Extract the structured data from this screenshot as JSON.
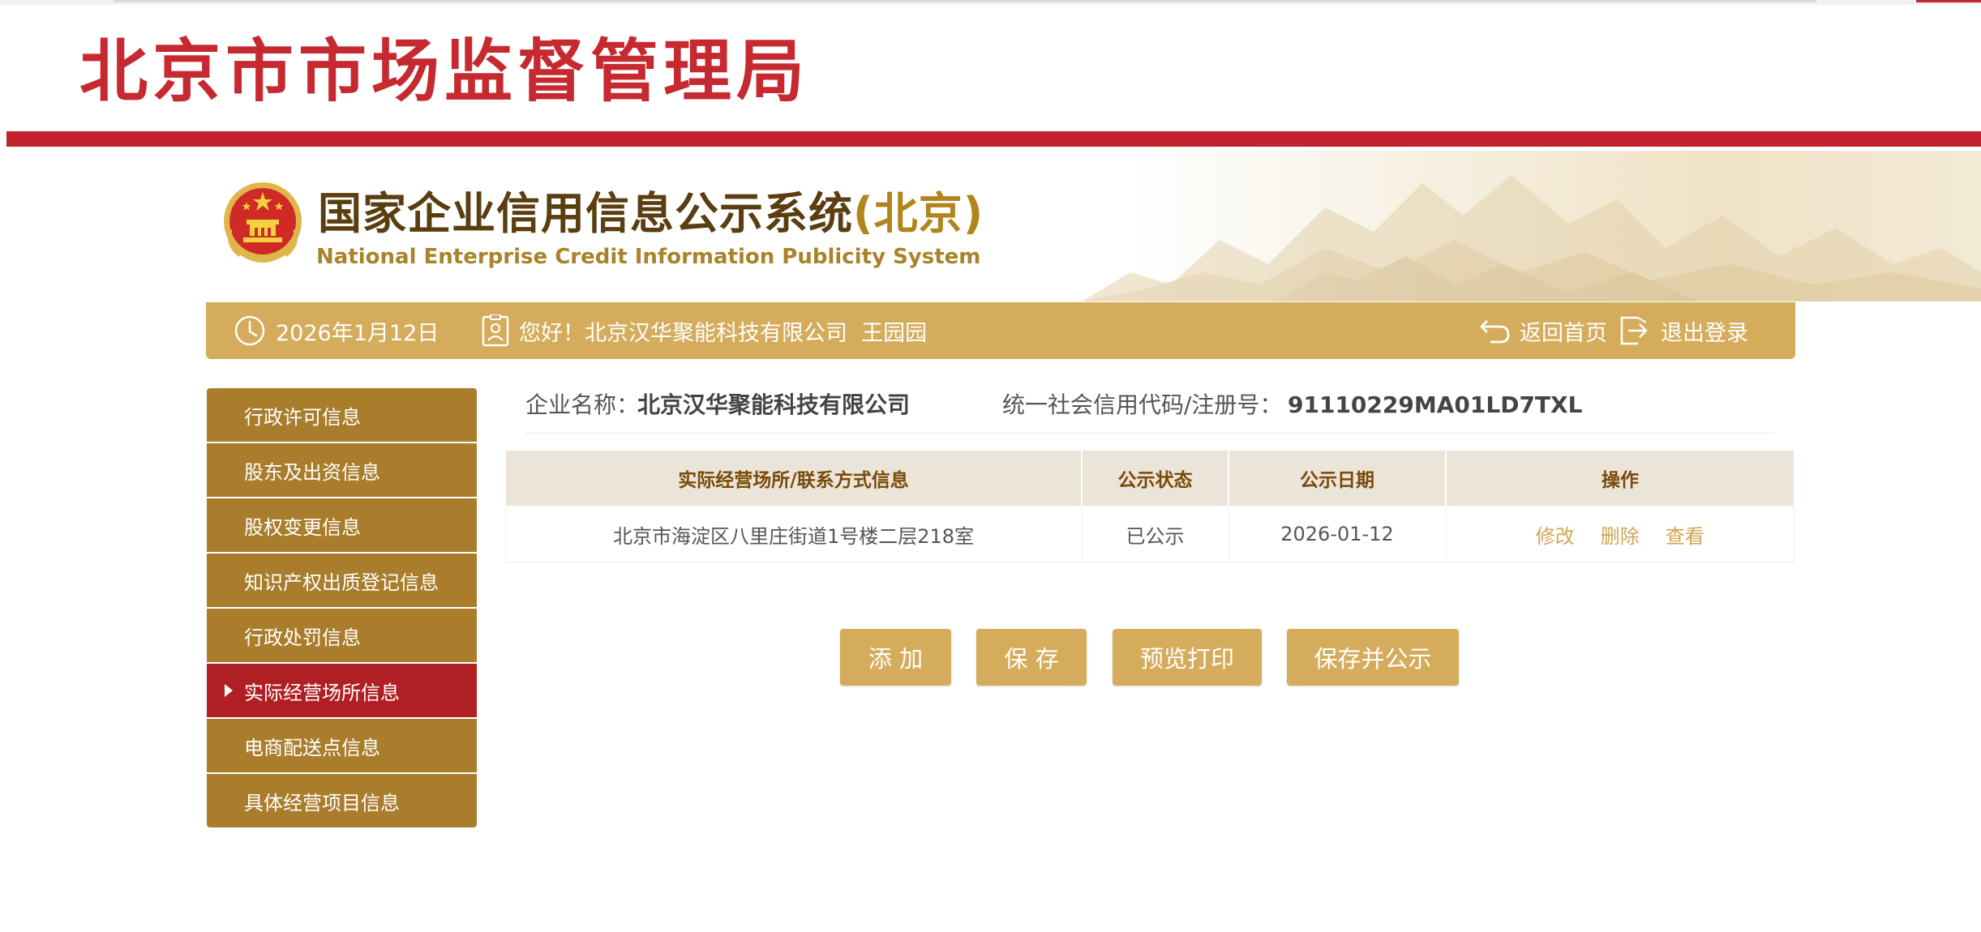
{
  "header": {
    "agency_title": "北京市市场监督管理局"
  },
  "banner": {
    "system_title_cn": "国家企业信用信息公示系统",
    "system_title_region": "(北京)",
    "system_title_en": "National Enterprise Credit Information Publicity System"
  },
  "infobar": {
    "date": "2026年1月12日",
    "greeting": "您好！北京汉华聚能科技有限公司  王园园",
    "home_label": "返回首页",
    "logout_label": "退出登录"
  },
  "sidebar": {
    "items": [
      {
        "label": "行政许可信息",
        "active": false
      },
      {
        "label": "股东及出资信息",
        "active": false
      },
      {
        "label": "股权变更信息",
        "active": false
      },
      {
        "label": "知识产权出质登记信息",
        "active": false
      },
      {
        "label": "行政处罚信息",
        "active": false
      },
      {
        "label": "实际经营场所信息",
        "active": true
      },
      {
        "label": "电商配送点信息",
        "active": false
      },
      {
        "label": "具体经营项目信息",
        "active": false
      }
    ]
  },
  "company": {
    "name_label": "企业名称：",
    "name_value": "北京汉华聚能科技有限公司",
    "code_label": "统一社会信用代码/注册号：",
    "code_value": "91110229MA01LD7TXL"
  },
  "table": {
    "headers": [
      "实际经营场所/联系方式信息",
      "公示状态",
      "公示日期",
      "操作"
    ],
    "rows": [
      {
        "address": "北京市海淀区八里庄街道1号楼二层218室",
        "status": "已公示",
        "date": "2026-01-12",
        "actions": [
          "修改",
          "删除",
          "查看"
        ]
      }
    ]
  },
  "buttons": {
    "add": "添 加",
    "save": "保 存",
    "preview_print": "预览打印",
    "save_publish": "保存并公示"
  },
  "colors": {
    "brand_red": "#c0222e",
    "gold": "#d4ac5c",
    "sidebar_gold": "#a97d2c",
    "sidebar_active": "#b01f24",
    "table_header_bg": "#ebe4d8",
    "action_link": "#d1a653"
  },
  "icons": {
    "date": "clock-icon",
    "user": "user-card-icon",
    "home": "return-arrow-icon",
    "logout": "logout-icon",
    "emblem": "national-emblem-icon"
  }
}
